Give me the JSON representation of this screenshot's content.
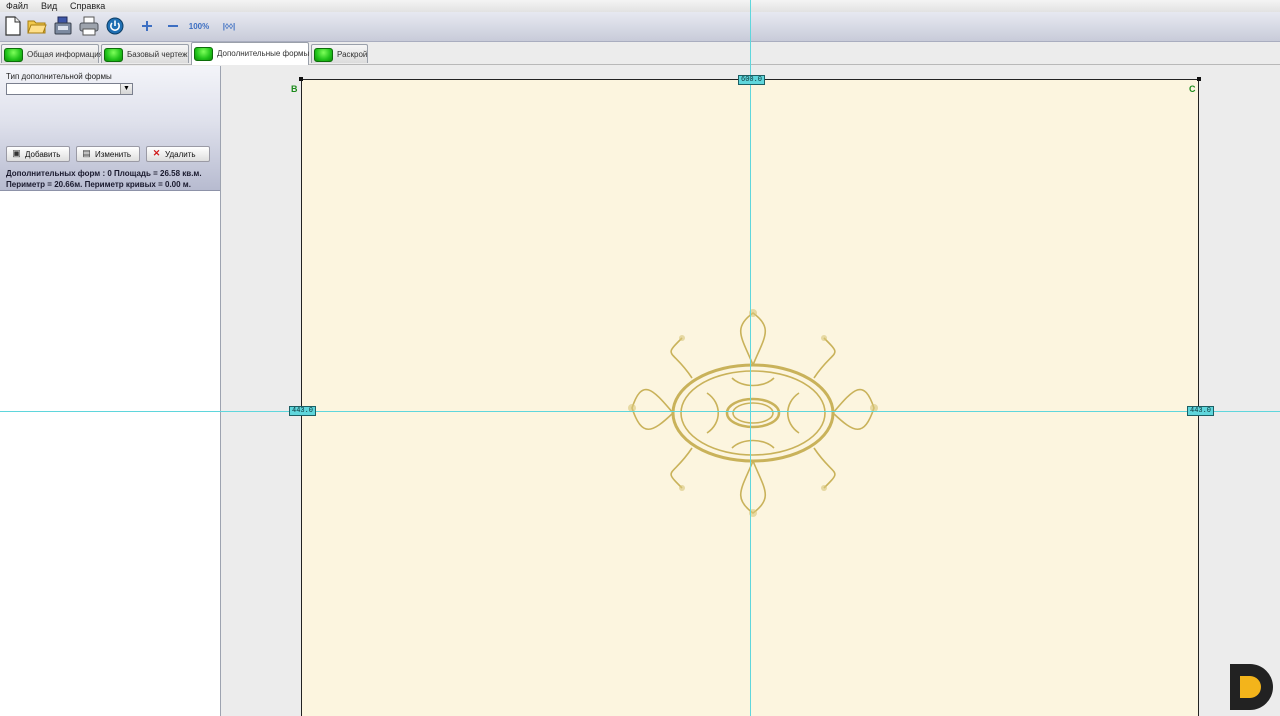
{
  "menu": {
    "items": [
      "Файл",
      "Вид",
      "Справка"
    ]
  },
  "toolbar": {
    "buttons": [
      "new-file-icon",
      "open-folder-icon",
      "save-icon",
      "print-icon",
      "power-icon",
      "zoom-in-icon",
      "zoom-out-icon",
      "zoom-100-icon",
      "zoom-fit-icon"
    ],
    "zoom_100_label": "100%",
    "zoom_fit_label": "|◊◊|"
  },
  "tabs": [
    {
      "label": "Общая информация",
      "active": false
    },
    {
      "label": "Базовый чертеж",
      "active": false
    },
    {
      "label": "Дополнительные формы",
      "active": true
    },
    {
      "label": "Раскрой",
      "active": false
    }
  ],
  "left_panel": {
    "type_label": "Тип дополнительной формы",
    "type_value": "",
    "buttons": {
      "add": "Добавить",
      "edit": "Изменить",
      "delete": "Удалить"
    },
    "stats_line1": "Дополнительных форм : 0 Площадь = 26.58 кв.м.",
    "stats_line2": "Периметр = 20.66м. Периметр кривых = 0.00 м."
  },
  "canvas": {
    "corner_b": "B",
    "corner_c": "C",
    "dim_top": "600.0",
    "dim_left": "443.0",
    "dim_right": "443.0"
  },
  "colors": {
    "sheet": "#fcf5df",
    "guide": "#5fd6dc",
    "tab_led": "#20c31a",
    "ornament": "#c9b25a",
    "logo_dark": "#222222",
    "logo_accent": "#f3b41b"
  }
}
